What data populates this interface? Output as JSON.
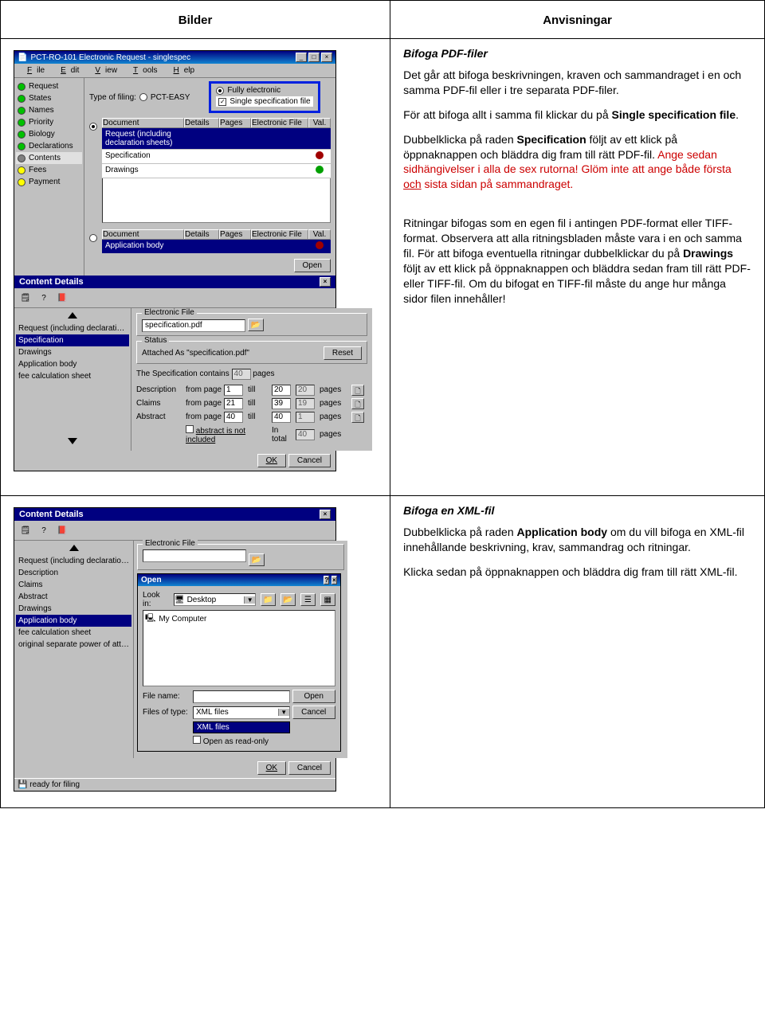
{
  "headers": {
    "left": "Bilder",
    "right": "Anvisningar"
  },
  "row1": {
    "app": {
      "title": "PCT-RO-101 Electronic Request - singlespec",
      "menu": {
        "file": "File",
        "edit": "Edit",
        "view": "View",
        "tools": "Tools",
        "help": "Help"
      },
      "sidebar": [
        {
          "label": "Request",
          "color": "green"
        },
        {
          "label": "States",
          "color": "green"
        },
        {
          "label": "Names",
          "color": "green"
        },
        {
          "label": "Priority",
          "color": "green"
        },
        {
          "label": "Biology",
          "color": "green"
        },
        {
          "label": "Declarations",
          "color": "green"
        },
        {
          "label": "Contents",
          "color": "grey"
        },
        {
          "label": "Fees",
          "color": "yellow"
        },
        {
          "label": "Payment",
          "color": "yellow"
        }
      ],
      "type_of_filing_label": "Type of filing:",
      "radio_pct_easy": "PCT-EASY",
      "radio_fully": "Fully electronic",
      "check_single": "Single specification file",
      "table1_header": {
        "doc": "Document",
        "det": "Details",
        "pag": "Pages",
        "file": "Electronic File",
        "val": "Val."
      },
      "table1_rows": [
        {
          "doc": "Request (including declaration sheets)",
          "val": ""
        },
        {
          "doc": "Specification",
          "val": "red"
        },
        {
          "doc": "Drawings",
          "val": "green"
        }
      ],
      "table2_rows": [
        {
          "doc": "Application body",
          "val": "red"
        }
      ],
      "open_btn": "Open",
      "content_details_title": "Content Details",
      "det_left": [
        "Request (including declaration s…",
        "Specification",
        "Drawings",
        "Application body",
        "fee calculation sheet"
      ],
      "det_left_sel": 1,
      "ef_group": "Electronic File",
      "ef_value": "specification.pdf",
      "status_group": "Status",
      "status_text": "Attached As \"specification.pdf\"",
      "reset_btn": "Reset",
      "spec_contains_pre": "The Specification contains",
      "spec_contains_val": "40",
      "spec_contains_post": "pages",
      "rows": {
        "desc": "Description",
        "claims": "Claims",
        "abstract": "Abstract",
        "from": "from page",
        "till": "till",
        "pages": "pages",
        "intotal": "In total"
      },
      "vals": {
        "desc_from": "1",
        "desc_till": "20",
        "desc_p": "20",
        "claims_from": "21",
        "claims_till": "39",
        "claims_p": "19",
        "abs_from": "40",
        "abs_till": "40",
        "abs_p": "1",
        "total": "40"
      },
      "abs_not_included": "abstract is not included",
      "ok": "OK",
      "cancel": "Cancel"
    },
    "text": {
      "h1": "Bifoga PDF-filer",
      "p1": "Det går att bifoga beskrivningen, kraven och sammandraget i en och samma PDF-fil eller i tre separata PDF-filer.",
      "p2a": "För att bifoga allt i samma fil klickar du på ",
      "p2b": "Single specification file",
      "p2c": ".",
      "p3a": "Dubbelklicka på raden ",
      "p3b": "Specification",
      "p3c": " följt av ett klick på öppnaknappen och bläddra dig fram till rätt PDF-fil. ",
      "p3d": "Ange sedan sidhängivelser i alla de sex rutorna!",
      "p3e": " Glöm inte att ange både första ",
      "p3f": "och",
      "p3g": " sista sidan på sammandraget.",
      "p4a": "Ritningar bifogas som en egen fil i antingen PDF-format eller TIFF-format. Observera att alla ritningsbladen måste vara i en och samma fil. För att bifoga eventuella ritningar dubbelklickar du på ",
      "p4b": "Drawings",
      "p4c": " följt av ett klick på öppnaknappen och bläddra sedan fram till rätt PDF- eller TIFF-fil. Om du bifogat en TIFF-fil måste du ange hur många sidor filen innehåller!"
    }
  },
  "row2": {
    "app": {
      "content_details_title": "Content Details",
      "det_left": [
        "Request (including declaration s…",
        "Description",
        "Claims",
        "Abstract",
        "Drawings",
        "Application body",
        "fee calculation sheet",
        "original separate power of attorne…"
      ],
      "det_left_sel": 5,
      "ef_group": "Electronic File",
      "open_title": "Open",
      "lookin": "Look in:",
      "lookin_val": "Desktop",
      "filelist_item": "My Computer",
      "filename_lbl": "File name:",
      "filetype_lbl": "Files of type:",
      "filetype_val": "XML files",
      "dd_item": "XML files",
      "readonly": "Open as read-only",
      "open_btn": "Open",
      "cancel_btn": "Cancel",
      "ok": "OK",
      "cancel": "Cancel",
      "status": "ready for filing"
    },
    "text": {
      "h1": "Bifoga en XML-fil",
      "p1a": "Dubbelklicka på raden ",
      "p1b": "Application body",
      "p1c": " om du vill bifoga en XML-fil innehållande beskrivning, krav, sammandrag och ritningar.",
      "p2": "Klicka sedan på öppnaknappen och bläddra dig fram till rätt XML-fil."
    }
  }
}
